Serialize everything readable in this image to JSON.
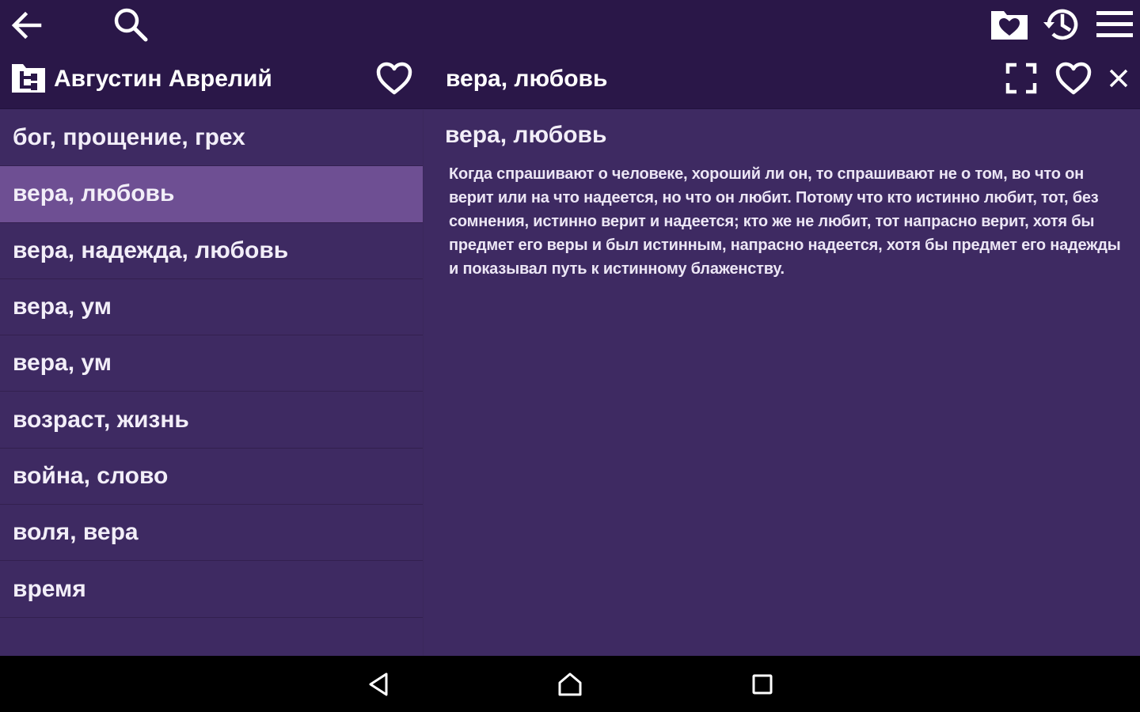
{
  "toolbar": {
    "author": "Августин Аврелий",
    "quote_title": "вера, любовь",
    "icons": {
      "back": "arrow-left-icon",
      "search": "search-icon",
      "favorites_folder": "folder-heart-icon",
      "history": "history-icon",
      "menu": "hamburger-menu-icon",
      "author": "author-tree-icon",
      "favorite": "heart-outline-icon",
      "fullscreen": "fullscreen-icon",
      "close": "close-icon"
    }
  },
  "topics": [
    {
      "label": "бог, прощение, грех",
      "selected": false
    },
    {
      "label": "вера, любовь",
      "selected": true
    },
    {
      "label": "вера, надежда, любовь",
      "selected": false
    },
    {
      "label": "вера, ум",
      "selected": false
    },
    {
      "label": "вера, ум",
      "selected": false
    },
    {
      "label": "возраст, жизнь",
      "selected": false
    },
    {
      "label": "война, слово",
      "selected": false
    },
    {
      "label": "воля, вера",
      "selected": false
    },
    {
      "label": "время",
      "selected": false
    }
  ],
  "detail": {
    "heading": "вера, любовь",
    "text": "Когда спрашивают о человеке, хороший ли он, то спрашивают не о том, во что он верит или на что надеется, но что он любит. Потому что кто истинно любит, тот, без сомнения, истинно верит и надеется; кто же не любит, тот напрасно верит, хотя бы предмет его веры и был истинным, напрасно надеется, хотя бы предмет его надежды и показывал путь к истинному блаженству."
  },
  "colors": {
    "toolbar_bg": "#2a1748",
    "content_bg": "#3e2a62",
    "selected_bg": "#6e4f93",
    "navbar_bg": "#000000"
  }
}
